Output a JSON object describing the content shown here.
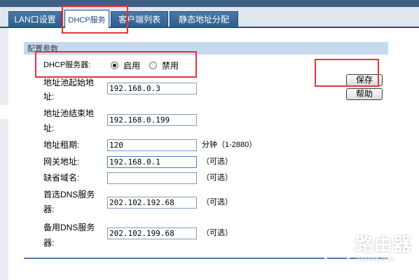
{
  "tabs": [
    {
      "label": "LAN口设置"
    },
    {
      "label": "DHCP服务",
      "active": true
    },
    {
      "label": "客户端列表"
    },
    {
      "label": "静态地址分配"
    }
  ],
  "section": {
    "title": "配置参数"
  },
  "dhcp_server": {
    "label": "DHCP服务器:",
    "options": [
      {
        "label": "启用",
        "checked": true
      },
      {
        "label": "禁用",
        "checked": false
      }
    ]
  },
  "fields": {
    "start": {
      "label_line1": "地址池起始地",
      "label_line2": "址:",
      "value": "192.168.0.3"
    },
    "end": {
      "label_line1": "地址池结束地",
      "label_line2": "址:",
      "value": "192.168.0.199"
    },
    "lease": {
      "label": "地址租期:",
      "value": "120",
      "hint": "分钟（1-2880）"
    },
    "gateway": {
      "label": "网关地址:",
      "value": "192.168.0.1",
      "hint": "（可选）"
    },
    "domain": {
      "label": "缺省域名:",
      "value": "",
      "hint": "（可选）"
    },
    "dns1": {
      "label_line1": "首选DNS服务",
      "label_line2": "器:",
      "value": "202.102.192.68",
      "hint": "（可选）"
    },
    "dns2": {
      "label_line1": "备用DNS服务",
      "label_line2": "器:",
      "value": "202.102.199.68",
      "hint": "（可选）"
    }
  },
  "buttons": {
    "save": "保存",
    "help": "帮助"
  },
  "watermark": {
    "text": "路由器",
    "sub": "luyouqi.com"
  },
  "colors": {
    "annotation_red": "#e8313a",
    "tab_blue": "#2f5f8e",
    "section_bg": "#c7d9ee"
  }
}
